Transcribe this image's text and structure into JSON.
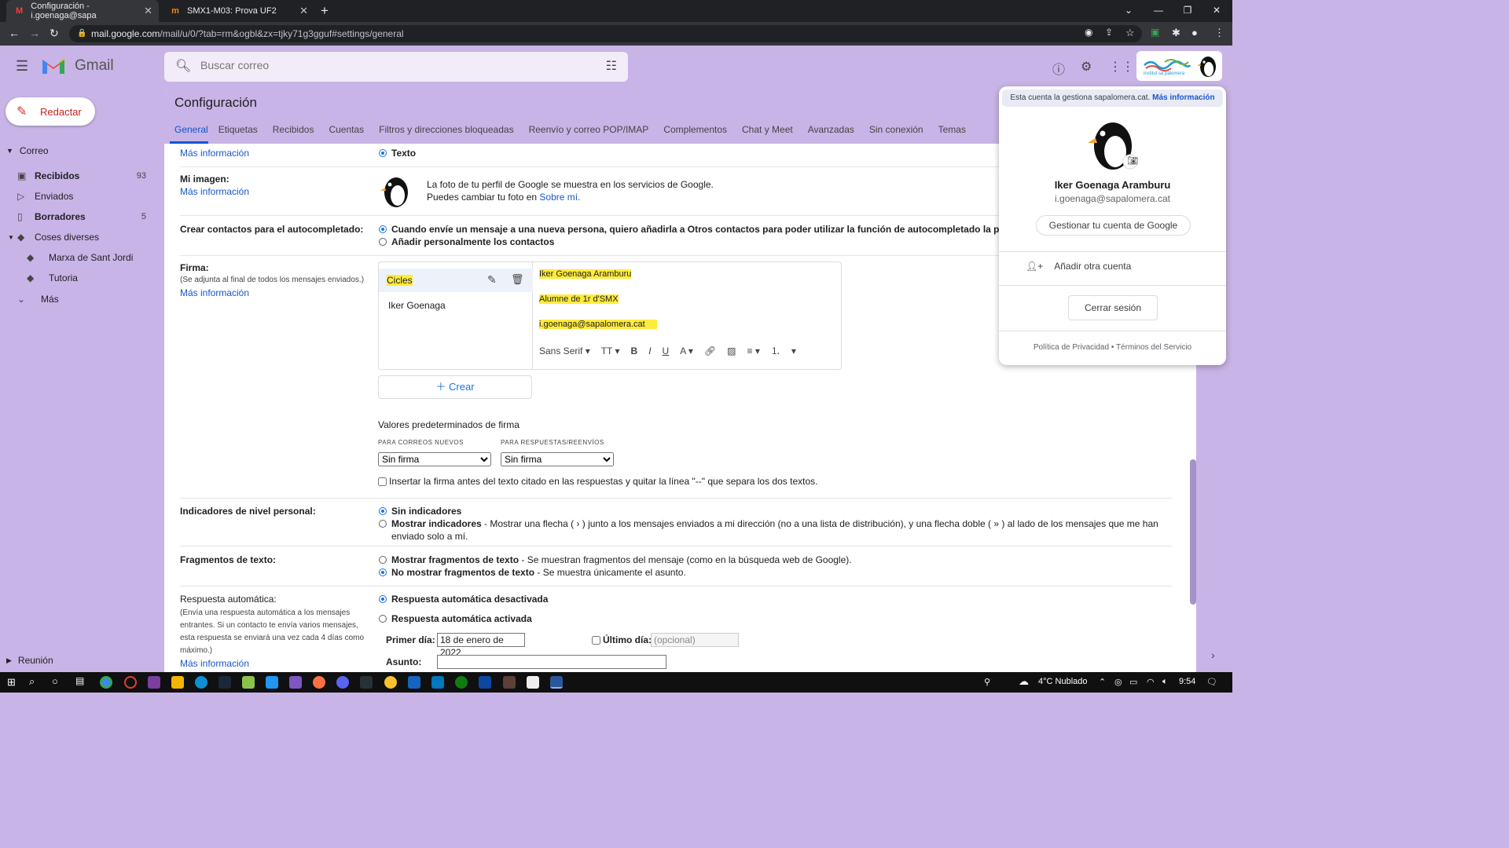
{
  "browser": {
    "tabs": [
      {
        "title": "Configuración - i.goenaga@sapa",
        "active": true,
        "icon": "gmail-icon"
      },
      {
        "title": "SMX1-M03: Prova UF2",
        "active": false,
        "icon": "moodle-icon"
      }
    ],
    "url_host": "mail.google.com",
    "url_path": "/mail/u/0/?tab=rm&ogbl&zx=tjky71g3gguf#settings/general"
  },
  "header": {
    "app_name": "Gmail",
    "search_placeholder": "Buscar correo"
  },
  "sidebar": {
    "compose_label": "Redactar",
    "section_label": "Correo",
    "items": [
      {
        "label": "Recibidos",
        "count": "93",
        "bold": true,
        "icon": "inbox-icon"
      },
      {
        "label": "Enviados",
        "count": "",
        "bold": false,
        "icon": "send-icon"
      },
      {
        "label": "Borradores",
        "count": "5",
        "bold": true,
        "icon": "draft-icon"
      },
      {
        "label": "Coses diverses",
        "count": "",
        "bold": false,
        "icon": "label-icon"
      },
      {
        "label": "Marxa de Sant Jordi",
        "count": "",
        "bold": false,
        "icon": "label-icon"
      },
      {
        "label": "Tutoria",
        "count": "",
        "bold": false,
        "icon": "label-icon"
      },
      {
        "label": "Más",
        "count": "",
        "bold": false,
        "icon": "chevron-down-icon"
      }
    ],
    "meet_label": "Reunión"
  },
  "settings": {
    "title": "Configuración",
    "tabs": [
      "General",
      "Etiquetas",
      "Recibidos",
      "Cuentas",
      "Filtros y direcciones bloqueadas",
      "Reenvío y correo POP/IMAP",
      "Complementos",
      "Chat y Meet",
      "Avanzadas",
      "Sin conexión",
      "Temas"
    ],
    "more_info": "Más información",
    "text_option": "Texto",
    "image": {
      "label": "Mi imagen:",
      "line1": "La foto de tu perfil de Google se muestra en los servicios de Google.",
      "line2": "Puedes cambiar tu foto en ",
      "link": "Sobre mí."
    },
    "contacts": {
      "label": "Crear contactos para el autocompletado:",
      "opt1": "Cuando envíe un mensaje a una nueva persona, quiero añadirla a Otros contactos para poder utilizar la función de autocompletado la próxima vez",
      "opt2": "Añadir personalmente los contactos"
    },
    "signature": {
      "label": "Firma:",
      "sublabel": "(Se adjunta al final de todos los mensajes enviados.)",
      "list": [
        "Cicles",
        "Iker Goenaga"
      ],
      "body": [
        "Iker Goenaga Aramburu",
        "Alumne de 1r d'SMX",
        "i.goenaga@sapalomera.cat"
      ],
      "font": "Sans Serif",
      "create": "Crear",
      "defaults_title": "Valores predeterminados de firma",
      "new_label": "PARA CORREOS NUEVOS",
      "reply_label": "PARA RESPUESTAS/REENVÍOS",
      "new_value": "Sin firma",
      "reply_value": "Sin firma",
      "insert_text": "Insertar la firma antes del texto citado en las respuestas y quitar la línea \"--\" que separa los dos textos."
    },
    "indicators": {
      "label": "Indicadores de nivel personal:",
      "opt1": "Sin indicadores",
      "opt2_bold": "Mostrar indicadores",
      "opt2_rest": " - Mostrar una flecha ( › ) junto a los mensajes enviados a mi dirección (no a una lista de distribución), y una flecha doble ( » ) al lado de los mensajes que me han",
      "opt2_line2": "enviado solo a mí."
    },
    "snippets": {
      "label": "Fragmentos de texto:",
      "opt1_bold": "Mostrar fragmentos de texto",
      "opt1_rest": " - Se muestran fragmentos del mensaje (como en la búsqueda web de Google).",
      "opt2_bold": "No mostrar fragmentos de texto",
      "opt2_rest": " - Se muestra únicamente el asunto."
    },
    "autoreply": {
      "label": "Respuesta automática:",
      "sub": [
        "(Envía una respuesta automática a los mensajes",
        "entrantes. Si un contacto te envía varios mensajes,",
        "esta respuesta se enviará una vez cada 4 días como",
        "máximo.)"
      ],
      "off": "Respuesta automática desactivada",
      "on": "Respuesta automática activada",
      "first_day_label": "Primer día:",
      "first_day_value": "18 de enero de 2022",
      "last_day_label": "Último día:",
      "last_day_placeholder": "(opcional)",
      "subject_label": "Asunto:"
    }
  },
  "account": {
    "managed_text": "Esta cuenta la gestiona ",
    "managed_domain": "sapalomera.cat",
    "managed_link": "Más información",
    "name": "Iker Goenaga Aramburu",
    "email": "i.goenaga@sapalomera.cat",
    "manage_button": "Gestionar tu cuenta de Google",
    "add_account": "Añadir otra cuenta",
    "logout": "Cerrar sesión",
    "privacy": "Política de Privacidad",
    "terms": "Términos del Servicio",
    "badge_text": "institut sa palomera"
  },
  "taskbar": {
    "weather": "4°C  Nublado",
    "time": "9:54"
  },
  "colors": {
    "accent": "#0b57d0",
    "header_bg": "#c8b4e6",
    "highlight": "#ffeb3b"
  }
}
